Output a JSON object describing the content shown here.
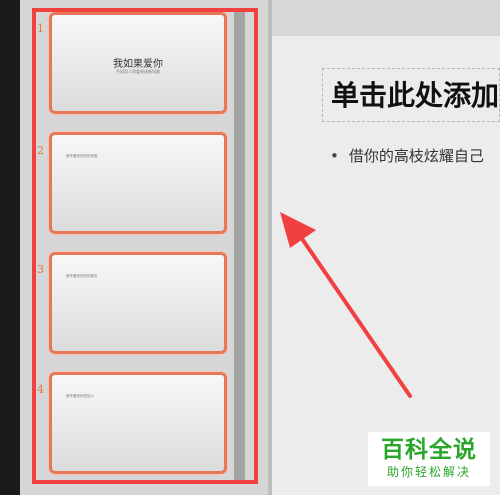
{
  "slide_panel": {
    "slides": [
      {
        "number": "1",
        "title": "我如果爱你",
        "subtitle": "不如用人同爱秘诀新叫剧",
        "bullet": ""
      },
      {
        "number": "2",
        "title": "",
        "subtitle": "",
        "bullet": "我不爱你还你的安宽"
      },
      {
        "number": "3",
        "title": "",
        "subtitle": "",
        "bullet": "我不爱你还你的能去"
      },
      {
        "number": "4",
        "title": "",
        "subtitle": "",
        "bullet": "我不爱你你还如人"
      }
    ]
  },
  "editor": {
    "title_placeholder": "单击此处添加标题",
    "bullet_text": "借你的高枝炫耀自己"
  },
  "logo": {
    "main": "百科全说",
    "sub": "助你轻松解决"
  },
  "colors": {
    "highlight_frame": "#f04040",
    "thumb_border": "#e8765a",
    "slide_number": "#e07a3b",
    "logo_green": "#2aa62a"
  }
}
